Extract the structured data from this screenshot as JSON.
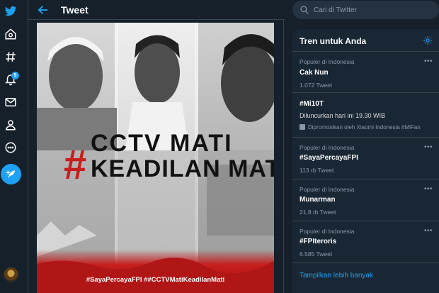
{
  "header": {
    "title": "Tweet"
  },
  "nav": {
    "notifications_badge": "5"
  },
  "media": {
    "headline_hash": "#",
    "headline_line1": "CCTV MATI",
    "headline_line2": "KEADILAN MATI",
    "caption": "#SayaPercayaFPI ##CCTVMatiKeadilanMati"
  },
  "search": {
    "placeholder": "Cari di Twitter"
  },
  "trends": {
    "title": "Tren untuk Anda",
    "items": [
      {
        "context": "Populer di Indonesia",
        "name": "Cak Nun",
        "meta": "1.072 Tweet"
      },
      {
        "name": "#Mi10T",
        "description": "Diluncurkan hari ini 19.30 WIB",
        "promoted": "Dipromosikan oleh Xiaomi Indonesia #MiFan"
      },
      {
        "context": "Populer di Indonesia",
        "name": "#SayaPercayaFPI",
        "meta": "113 rb Tweet"
      },
      {
        "context": "Populer di Indonesia",
        "name": "Munarman",
        "meta": "21,8 rb Tweet"
      },
      {
        "context": "Populer di Indonesia",
        "name": "#FPIteroris",
        "meta": "6.585 Tweet"
      }
    ],
    "show_more": "Tampilkan lebih banyak"
  },
  "colors": {
    "background": "#15202b",
    "panel": "#192734",
    "accent": "#1da1f2",
    "flag_red": "#c81e1e"
  }
}
